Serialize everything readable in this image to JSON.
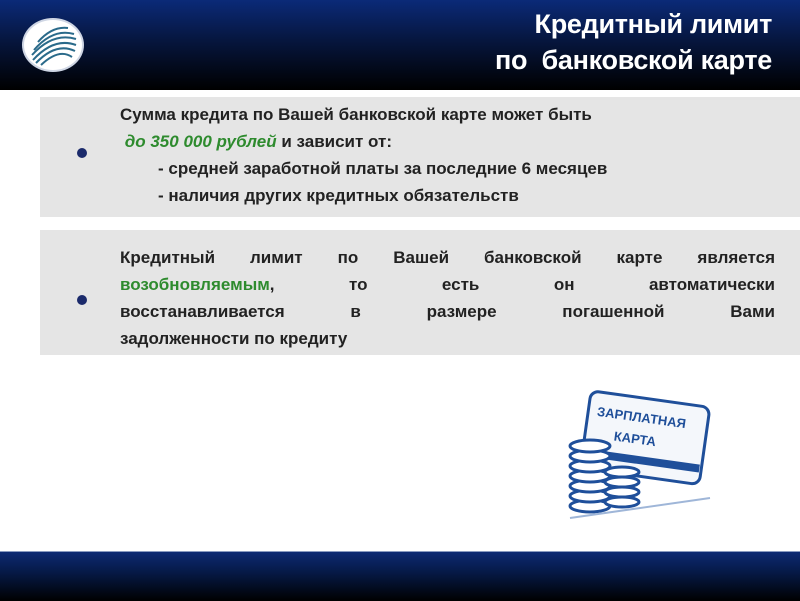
{
  "header": {
    "title_lines": [
      "Кредитный лимит",
      "по  банковской карте"
    ]
  },
  "block1": {
    "line1": "Сумма  кредита по Вашей банковской карте может быть",
    "amount": "до 350 000 рублей",
    "line2_rest": " и зависит от:",
    "items": [
      "- средней заработной платы за последние 6 месяцев",
      "- наличия других кредитных обязательств"
    ]
  },
  "block2": {
    "line1": "Кредитный лимит по Вашей банковской карте является",
    "highlight": "возобновляемым",
    "line2_rest": ", то есть он автоматически",
    "line3": "восстанавливается в размере погашенной Вами",
    "line4": "задолженности по кредиту"
  },
  "illustration": {
    "card_text": [
      "ЗАРПЛАТНАЯ",
      "КАРТА"
    ]
  },
  "colors": {
    "accent_green": "#2e8b2e",
    "header_blue": "#0b2a78",
    "bullet": "#1b2a6b"
  }
}
